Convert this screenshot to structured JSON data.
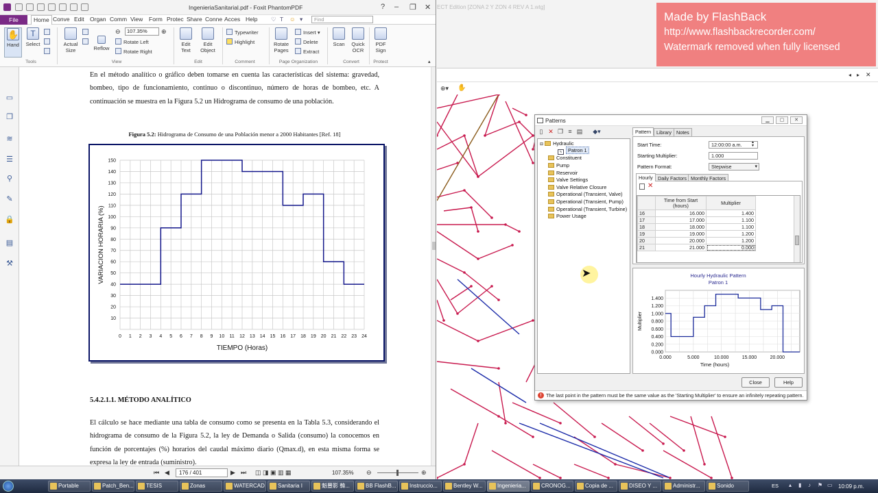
{
  "foxit": {
    "title": "IngenieriaSanitarial.pdf - Foxit PhantomPDF",
    "window_controls": [
      "?",
      "–",
      "❐",
      "✕"
    ],
    "tabs": [
      "File",
      "Home",
      "Conve",
      "Edit",
      "Organ",
      "Comm",
      "View",
      "Form",
      "Protec",
      "Share",
      "Conne",
      "Acces",
      "Help"
    ],
    "find_placeholder": "Find",
    "ribbon": {
      "hand": "Hand",
      "select": "Select",
      "actual_size": "Actual Size",
      "reflow": "Reflow",
      "zoom": "107.35%",
      "rotate_left": "Rotate Left",
      "rotate_right": "Rotate Right",
      "edit_text": "Edit Text",
      "edit_object": "Edit Object",
      "typewriter": "Typewriter",
      "highlight": "Highlight",
      "rotate_pages": "Rotate Pages",
      "insert": "Insert",
      "delete": "Delete",
      "extract": "Extract",
      "scan": "Scan",
      "quick_ocr": "Quick OCR",
      "pdf_sign": "PDF Sign",
      "groups": [
        "Tools",
        "View",
        "Edit",
        "Comment",
        "Page Organization",
        "Convert",
        "Protect"
      ]
    },
    "doc": {
      "para1": "En el método analítico o gráfico deben tomarse en cuenta las características del sistema: gravedad, bombeo, tipo de funcionamiento, continuo o discontinuo, número de horas de bombeo, etc. A continuación se muestra en la Figura 5.2 un Hidrograma de consumo de una población.",
      "fig_caption_bold": "Figura 5.2:",
      "fig_caption": " Hidrograma de Consumo de una Población menor a 2000 Habitantes [Ref. 18]",
      "heading": "5.4.2.1.1.  MÉTODO  ANALÍTICO",
      "para2": "El cálculo se hace mediante una tabla de consumo como se presenta en la Tabla 5.3, considerando el hidrograma de consumo de la Figura 5.2, la ley de Demanda o Salida (consumo) la conocemos en función de porcentajes (%) horarios del caudal máximo diario (Qmax.d), en esta misma forma se expresa la ley de entrada (suministro)."
    },
    "status": {
      "page": "176 / 401",
      "zoom": "107.35%"
    }
  },
  "watercad": {
    "title_fragment": "ECT Edition [ZONA 2 Y ZON 4 REV A 1.wtg]",
    "ribbon_search": "Ribbon (F3)"
  },
  "watermark": {
    "line1": "Made by FlashBack",
    "line2": "http://www.flashbackrecorder.com/",
    "line3": "Watermark removed when fully licensed"
  },
  "patterns_dialog": {
    "title": "Patterns",
    "tree": {
      "root": "Hydraulic",
      "child": "Patron 1",
      "folders": [
        "Constituent",
        "Pump",
        "Reservoir",
        "Valve Settings",
        "Valve Relative Closure",
        "Operational (Transient, Valve)",
        "Operational (Transient, Pump)",
        "Operational (Transient, Turbine)",
        "Power Usage"
      ]
    },
    "tabs": [
      "Pattern",
      "Library",
      "Notes"
    ],
    "start_time_label": "Start Time:",
    "start_time": "12:00:00 a.m.",
    "starting_multiplier_label": "Starting Multiplier:",
    "starting_multiplier": "1.000",
    "pattern_format_label": "Pattern Format:",
    "pattern_format": "Stepwise",
    "subtabs": [
      "Hourly",
      "Daily Factors",
      "Monthly Factors"
    ],
    "grid_headers": [
      "Time from Start (hours)",
      "Multiplier"
    ],
    "grid_rows": [
      {
        "idx": "16",
        "time": "16.000",
        "mult": "1.400"
      },
      {
        "idx": "17",
        "time": "17.000",
        "mult": "1.100"
      },
      {
        "idx": "18",
        "time": "18.000",
        "mult": "1.100"
      },
      {
        "idx": "19",
        "time": "19.000",
        "mult": "1.200"
      },
      {
        "idx": "20",
        "time": "20.000",
        "mult": "1.200"
      },
      {
        "idx": "21",
        "time": "21.000",
        "mult": "0.000"
      }
    ],
    "close": "Close",
    "help": "Help",
    "message": "The last point in the pattern must be the same value as the 'Starting Multiplier' to ensure an infinitely repeating pattern."
  },
  "chart_data": [
    {
      "type": "line",
      "xlabel": "TIEMPO   (Horas)",
      "ylabel": "VARIACION  HORARIA  (%)",
      "x_ticks": [
        0,
        1,
        2,
        3,
        4,
        5,
        6,
        7,
        8,
        9,
        10,
        11,
        12,
        13,
        14,
        15,
        16,
        17,
        18,
        19,
        20,
        21,
        22,
        23,
        24
      ],
      "y_ticks": [
        10,
        20,
        30,
        40,
        50,
        60,
        70,
        80,
        90,
        100,
        110,
        120,
        130,
        140,
        150
      ],
      "xlim": [
        0,
        24
      ],
      "ylim": [
        0,
        150
      ],
      "grid": true,
      "step_values": [
        40,
        40,
        40,
        40,
        90,
        90,
        120,
        120,
        150,
        150,
        150,
        150,
        140,
        140,
        140,
        140,
        110,
        110,
        120,
        120,
        60,
        60,
        40,
        40
      ]
    },
    {
      "type": "line",
      "title": "Hourly Hydraulic Pattern",
      "subtitle": "Patron 1",
      "xlabel": "Time (hours)",
      "ylabel": "Multiplier",
      "x_ticks": [
        "0.000",
        "5.000",
        "10.000",
        "15.000",
        "20.000"
      ],
      "y_ticks": [
        "0.000",
        "0.200",
        "0.400",
        "0.600",
        "0.800",
        "1.000",
        "1.200",
        "1.400"
      ],
      "xlim": [
        0,
        24
      ],
      "ylim": [
        0,
        1.6
      ],
      "grid": true,
      "step_values": [
        1.0,
        0.4,
        0.4,
        0.4,
        0.4,
        0.9,
        0.9,
        1.2,
        1.2,
        1.5,
        1.5,
        1.5,
        1.5,
        1.4,
        1.4,
        1.4,
        1.4,
        1.1,
        1.1,
        1.2,
        1.2,
        0.0,
        0.0,
        0.0
      ]
    }
  ],
  "taskbar": {
    "items": [
      "Portable",
      "Patch_Ben...",
      "TESIS",
      "Zonas",
      "WATERCAD",
      "Sanitaria I",
      "魁豐影 韓...",
      "BB FlashB...",
      "Instruccio...",
      "Bentley W...",
      "Ingenieria...",
      "CRONOG...",
      "Copia de ...",
      "DISEO Y ...",
      "Administr...",
      "Sonido"
    ],
    "lang": "ES",
    "clock": "10:09 p.m."
  }
}
